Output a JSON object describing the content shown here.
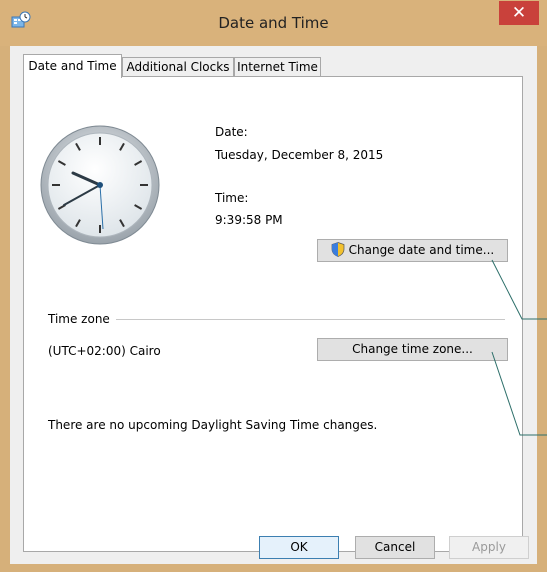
{
  "window": {
    "title": "Date and Time",
    "close_glyph": "✕"
  },
  "tabs": [
    {
      "label": "Date and Time",
      "active": true
    },
    {
      "label": "Additional Clocks",
      "active": false
    },
    {
      "label": "Internet Time",
      "active": false
    }
  ],
  "date": {
    "label": "Date:",
    "value": "Tuesday, December 8, 2015"
  },
  "time": {
    "label": "Time:",
    "value": "9:39:58 PM"
  },
  "buttons": {
    "change_date_time": "Change date and time...",
    "change_time_zone": "Change time zone...",
    "ok": "OK",
    "cancel": "Cancel",
    "apply": "Apply"
  },
  "time_zone": {
    "heading": "Time zone",
    "value": "(UTC+02:00) Cairo",
    "dst_message": "There are no upcoming Daylight Saving Time changes."
  },
  "colors": {
    "title_bar": "#d9b27b",
    "close_button": "#c9413b",
    "panel": "#efefef"
  },
  "icons": {
    "app": "date-time-icon",
    "shield": "uac-shield-icon",
    "close": "close-icon"
  }
}
